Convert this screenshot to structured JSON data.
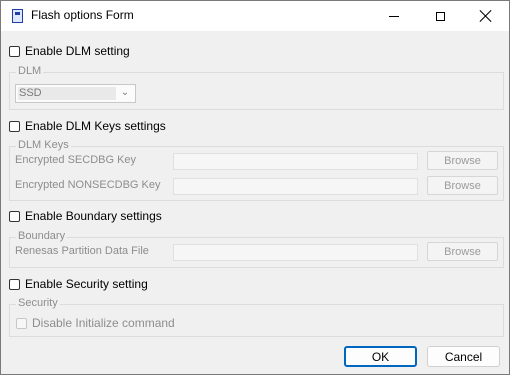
{
  "window": {
    "title": "Flash options Form"
  },
  "dlm": {
    "checkbox_label": "Enable DLM setting",
    "group_title": "DLM",
    "selected": "SSD"
  },
  "dlm_keys": {
    "checkbox_label": "Enable DLM Keys settings",
    "group_title": "DLM Keys",
    "secdbg_label": "Encrypted SECDBG Key",
    "nonsecdbg_label": "Encrypted NONSECDBG Key",
    "browse_label": "Browse"
  },
  "boundary": {
    "checkbox_label": "Enable Boundary settings",
    "group_title": "Boundary",
    "file_label": "Renesas Partition Data File",
    "browse_label": "Browse"
  },
  "security": {
    "checkbox_label": "Enable Security setting",
    "group_title": "Security",
    "disable_init_label": "Disable Initialize command"
  },
  "buttons": {
    "ok": "OK",
    "cancel": "Cancel"
  }
}
